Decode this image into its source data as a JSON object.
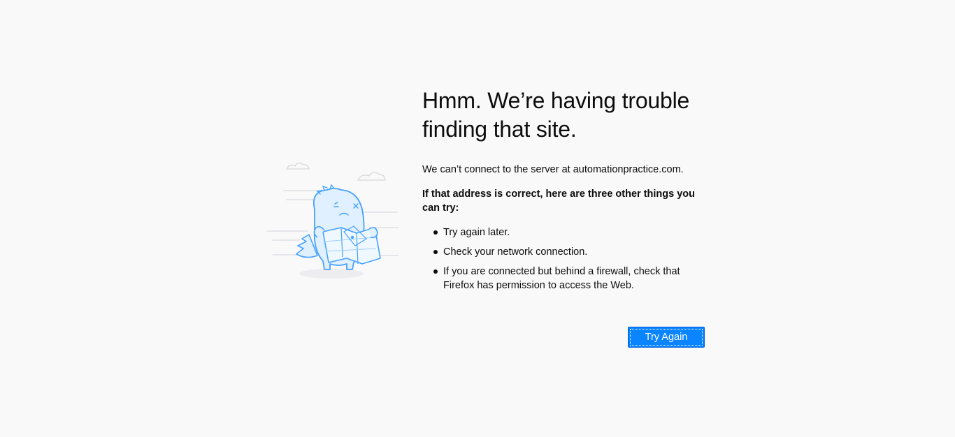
{
  "error_page": {
    "title": "Hmm. We’re having trouble finding that site.",
    "description": "We can’t connect to the server at automationpractice.com.",
    "hint": "If that address is correct, here are three other things you can try:",
    "tips": [
      "Try again later.",
      "Check your network connection.",
      "If you are connected but behind a firewall, check that Firefox has permission to access the Web."
    ],
    "try_again_label": "Try Again",
    "illustration_icon": "confused-dinosaur-with-map-icon"
  },
  "colors": {
    "background": "#f9f9fa",
    "text": "#0c0c0d",
    "accent": "#0a84ff",
    "illustration_stroke": "#45a1ff",
    "illustration_fill": "#e1f0ff"
  }
}
